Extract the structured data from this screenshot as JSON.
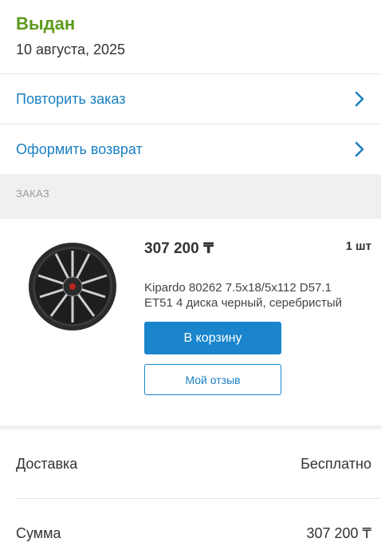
{
  "status": {
    "title": "Выдан",
    "date": "10 августа, 2025"
  },
  "actions": [
    {
      "label": "Повторить заказ",
      "icon": "chevron-right-icon"
    },
    {
      "label": "Оформить возврат",
      "icon": "chevron-right-icon"
    }
  ],
  "order_section": {
    "label": "ЗАКАЗ"
  },
  "product": {
    "price": "307 200 ₸",
    "quantity": "1 шт",
    "name": "Kipardo 80262 7.5x18/5x112 D57.1 ET51 4 диска черный, серебристый",
    "add_to_cart_label": "В корзину",
    "review_label": "Мой отзыв"
  },
  "summary": {
    "delivery_label": "Доставка",
    "delivery_value": "Бесплатно",
    "total_label": "Сумма",
    "total_value": "307 200 ₸"
  },
  "colors": {
    "status_green": "#5d9a1b",
    "link_blue": "#1a7fc1",
    "button_blue": "#1a85cc"
  }
}
